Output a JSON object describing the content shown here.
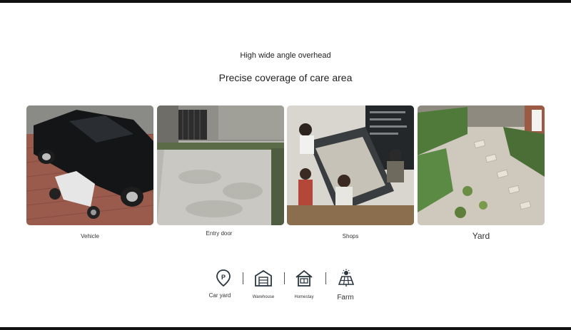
{
  "header": {
    "subtitle": "High wide angle overhead",
    "title": "Precise coverage of care area"
  },
  "scenes": [
    {
      "label": "Vehicle"
    },
    {
      "label": "Entry door"
    },
    {
      "label": "Shops"
    },
    {
      "label": "Yard"
    }
  ],
  "features": [
    {
      "label": "Car yard",
      "icon": "parking-pin-icon"
    },
    {
      "label": "Warehouse",
      "icon": "warehouse-icon"
    },
    {
      "label": "Homestay",
      "icon": "homestay-icon"
    },
    {
      "label": "Farm",
      "icon": "solar-farm-icon"
    }
  ],
  "colors": {
    "icon": "#2b3640",
    "text": "#222222",
    "frame": "#111111"
  }
}
